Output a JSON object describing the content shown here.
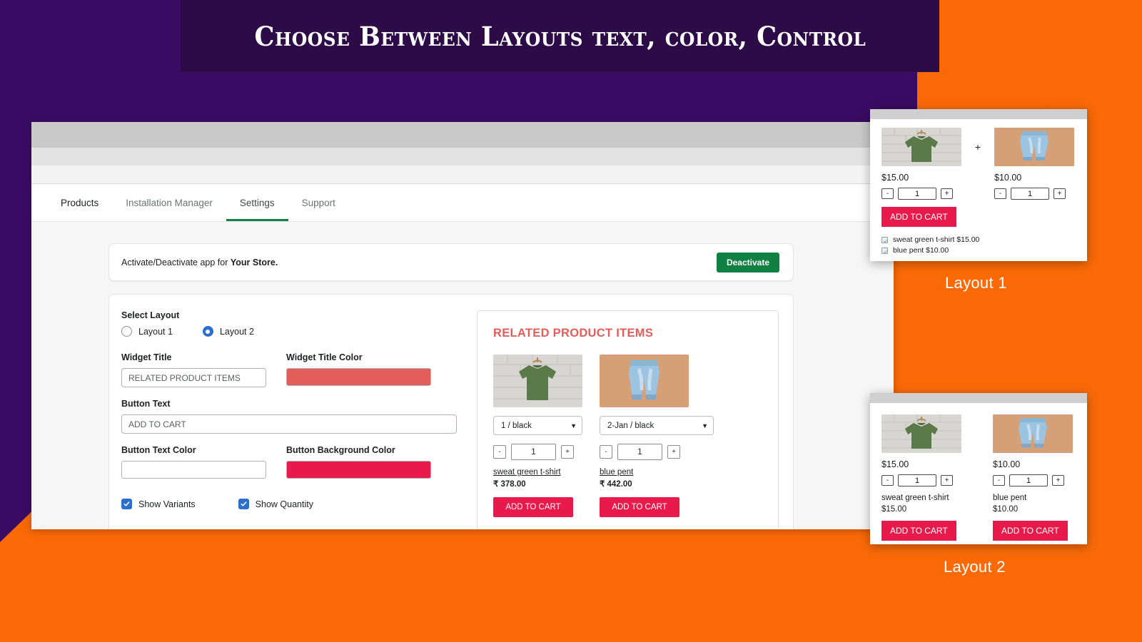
{
  "banner": {
    "title": "Choose Between Layouts text, color, Control"
  },
  "colors": {
    "purple": "#3A0B63",
    "banner_bg": "#2C0B47",
    "orange": "#F96A07",
    "green_button": "#108043",
    "accent_blue": "#2C6ECB",
    "widget_title_color": "#E35D5B",
    "button_background_color": "#E8194B",
    "button_text_color": "#FFFFFF"
  },
  "window": {
    "tabs": [
      {
        "label": "Products",
        "active": false
      },
      {
        "label": "Installation Manager",
        "active": false
      },
      {
        "label": "Settings",
        "active": true
      },
      {
        "label": "Support",
        "active": false
      }
    ],
    "activate_card": {
      "text_prefix": "Activate/Deactivate app for ",
      "store_name": "Your Store.",
      "button_label": "Deactivate"
    },
    "settings": {
      "select_layout_label": "Select Layout",
      "layout_options": [
        {
          "label": "Layout 1",
          "selected": false
        },
        {
          "label": "Layout 2",
          "selected": true
        }
      ],
      "widget_title_label": "Widget Title",
      "widget_title_value": "RELATED PRODUCT ITEMS",
      "widget_title_color_label": "Widget Title Color",
      "widget_title_color_value": "#E35D5B",
      "button_text_label": "Button Text",
      "button_text_value": "ADD TO CART",
      "button_text_color_label": "Button Text Color",
      "button_text_color_value": "#FFFFFF",
      "button_bg_color_label": "Button Background Color",
      "button_bg_color_value": "#E8194B",
      "show_variants_label": "Show Variants",
      "show_variants_checked": true,
      "show_quantity_label": "Show Quantity",
      "show_quantity_checked": true
    },
    "preview": {
      "title": "RELATED PRODUCT ITEMS",
      "items": [
        {
          "image": "green-tshirt-image",
          "variant": "1 / black",
          "qty_minus": "-",
          "qty_value": "1",
          "qty_plus": "+",
          "name": "sweat green t-shirt",
          "price": "₹ 378.00",
          "button_label": "ADD TO CART"
        },
        {
          "image": "blue-jeans-image",
          "variant": "2-Jan / black",
          "qty_minus": "-",
          "qty_value": "1",
          "qty_plus": "+",
          "name": "blue pent",
          "price": "₹ 442.00",
          "button_label": "ADD TO CART"
        }
      ]
    }
  },
  "layout1_card": {
    "caption": "Layout 1",
    "plus_sign": "+",
    "products": [
      {
        "image": "green-tshirt-image",
        "price": "$15.00",
        "qty_minus": "-",
        "qty_value": "1",
        "qty_plus": "+"
      },
      {
        "image": "blue-jeans-image",
        "price": "$10.00",
        "qty_minus": "-",
        "qty_value": "1",
        "qty_plus": "+"
      }
    ],
    "button_label": "ADD TO CART",
    "checklist": [
      "sweat green t-shirt $15.00",
      "blue pent $10.00"
    ]
  },
  "layout2_card": {
    "caption": "Layout 2",
    "products": [
      {
        "image": "green-tshirt-image",
        "price": "$15.00",
        "qty_minus": "-",
        "qty_value": "1",
        "qty_plus": "+",
        "name": "sweat green t-shirt",
        "price2": "$15.00",
        "button_label": "ADD TO CART"
      },
      {
        "image": "blue-jeans-image",
        "price": "$10.00",
        "qty_minus": "-",
        "qty_value": "1",
        "qty_plus": "+",
        "name": "blue pent",
        "price2": "$10.00",
        "button_label": "ADD TO CART"
      }
    ]
  }
}
